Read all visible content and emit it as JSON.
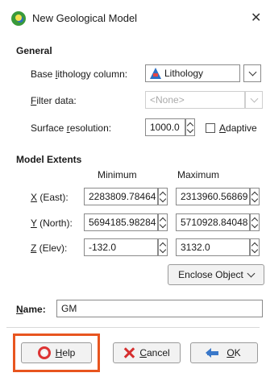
{
  "window": {
    "title": "New Geological Model",
    "close_glyph": "✕"
  },
  "general": {
    "title": "General",
    "base_lithology_label_pre": "Base ",
    "base_lithology_label_u": "l",
    "base_lithology_label_post": "ithology column:",
    "base_lithology_value": "Lithology",
    "filter_label_u": "F",
    "filter_label_post": "ilter data:",
    "filter_value": "<None>",
    "surface_label_pre": "Surface ",
    "surface_label_u": "r",
    "surface_label_post": "esolution:",
    "surface_value": "1000.0",
    "adaptive_label_u": "A",
    "adaptive_label_post": "daptive",
    "adaptive_checked": false
  },
  "extents": {
    "title": "Model Extents",
    "col_min": "Minimum",
    "col_max": "Maximum",
    "rows": [
      {
        "label_u": "X",
        "label_post": " (East):",
        "min": "2283809.78464",
        "max": "2313960.56869"
      },
      {
        "label_u": "Y",
        "label_post": " (North):",
        "min": "5694185.98284",
        "max": "5710928.84048"
      },
      {
        "label_u": "Z",
        "label_post": " (Elev):",
        "min": "-132.0",
        "max": "3132.0"
      }
    ],
    "enclose_label": "Enclose Object"
  },
  "name": {
    "label_u": "N",
    "label_post": "ame:",
    "value": "GM"
  },
  "buttons": {
    "help": "Help",
    "help_u": "H",
    "help_post": "elp",
    "cancel_u": "C",
    "cancel_post": "ancel",
    "ok_u": "O",
    "ok_post": "K"
  },
  "colors": {
    "highlight": "#e8551f"
  }
}
